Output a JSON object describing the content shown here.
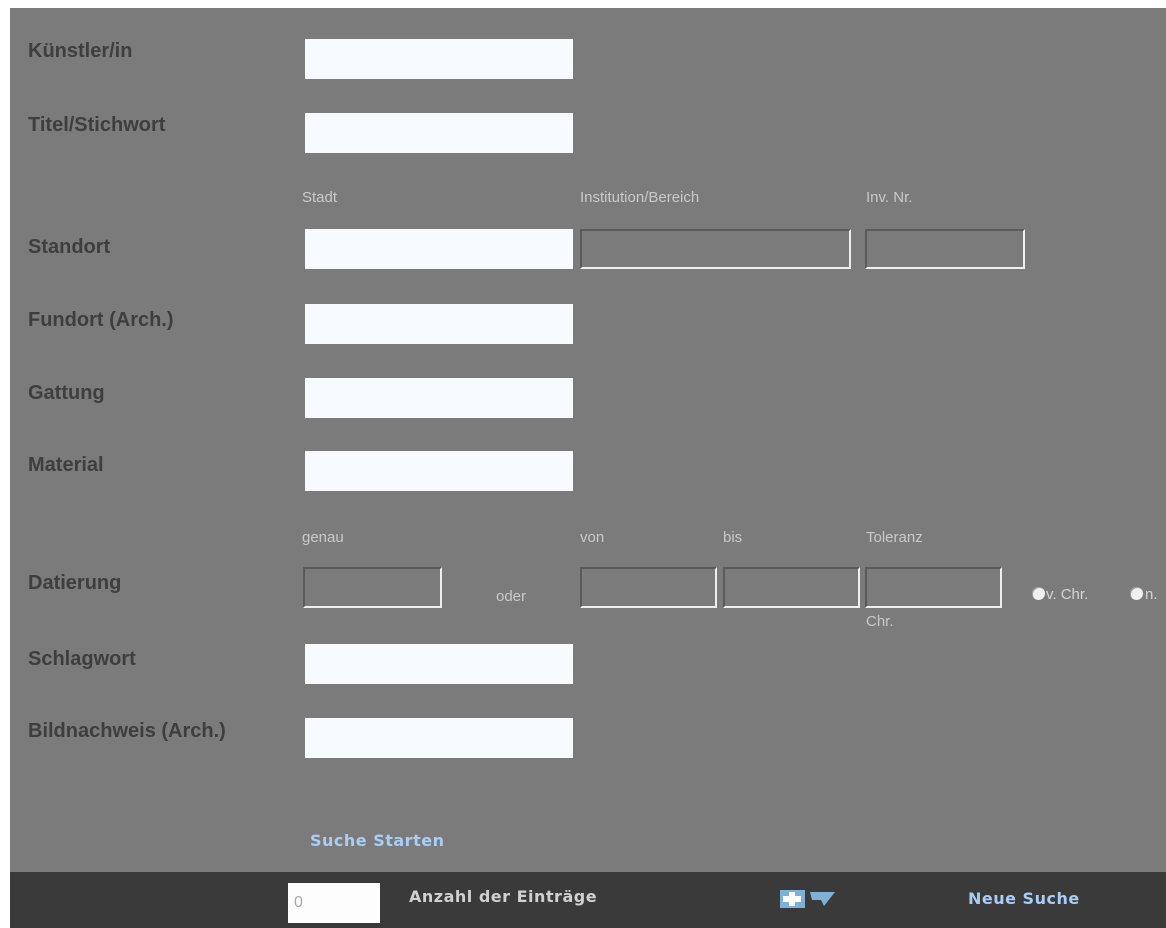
{
  "form": {
    "kuenstler_label": "Künstler/in",
    "titel_label": "Titel/Stichwort",
    "standort": {
      "label": "Standort",
      "stadt": "Stadt",
      "institution": "Institution/Bereich",
      "inv_nr": "Inv. Nr."
    },
    "fundort_label": "Fundort (Arch.)",
    "gattung_label": "Gattung",
    "material_label": "Material",
    "datierung": {
      "label": "Datierung",
      "genau": "genau",
      "oder": "oder",
      "von": "von",
      "bis": "bis",
      "toleranz": "Toleranz",
      "v_chr": "v. Chr.",
      "n_chr_prefix": "n.",
      "n_chr_suffix": "Chr."
    },
    "schlagwort_label": "Schlagwort",
    "bildnachweis_label": "Bildnachweis (Arch.)",
    "submit_label": "Suche Starten"
  },
  "footer": {
    "count_value": "0",
    "count_label": "Anzahl der Einträge",
    "toggle_icon": "plus-arrow-icon",
    "new_search_label": "Neue Suche"
  },
  "colors": {
    "panel_bg": "#7b7b7b",
    "footer_bg": "#3a3a3a",
    "link_accent": "#a9cdf5",
    "label_text": "#3e3e3e"
  }
}
